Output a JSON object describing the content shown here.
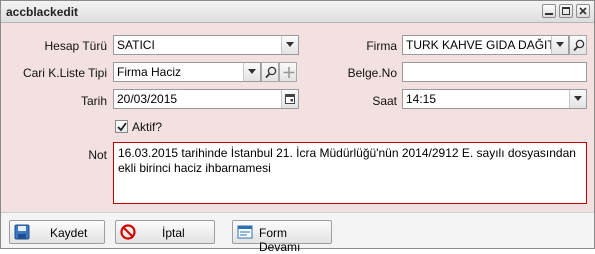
{
  "window": {
    "title": "accblackedit"
  },
  "form": {
    "hesap_turu": {
      "label": "Hesap Türü",
      "value": "SATICI"
    },
    "firma": {
      "label": "Firma",
      "value": "TURK KAHVE GIDA DAĞITI"
    },
    "cari_liste_tipi": {
      "label": "Cari K.Liste Tipi",
      "value": "Firma Haciz"
    },
    "belge_no": {
      "label": "Belge.No",
      "value": ""
    },
    "tarih": {
      "label": "Tarih",
      "value": "20/03/2015"
    },
    "saat": {
      "label": "Saat",
      "value": "14:15"
    },
    "aktif": {
      "label": "Aktif?",
      "checked": true
    },
    "not": {
      "label": "Not",
      "line1": "16.03.2015 tarihinde İstanbul 21. İcra Müdürlüğü'nün 2014/2912 E. sayılı dosyasından",
      "line2": "ekli birinci haciz ihbarnamesi"
    }
  },
  "footer": {
    "save_label": "Kaydet",
    "cancel_label": "İptal",
    "form_continue_label": "Form Devamı"
  },
  "colors": {
    "form_background": "#f3e1e1",
    "required_border": "#c00000"
  }
}
